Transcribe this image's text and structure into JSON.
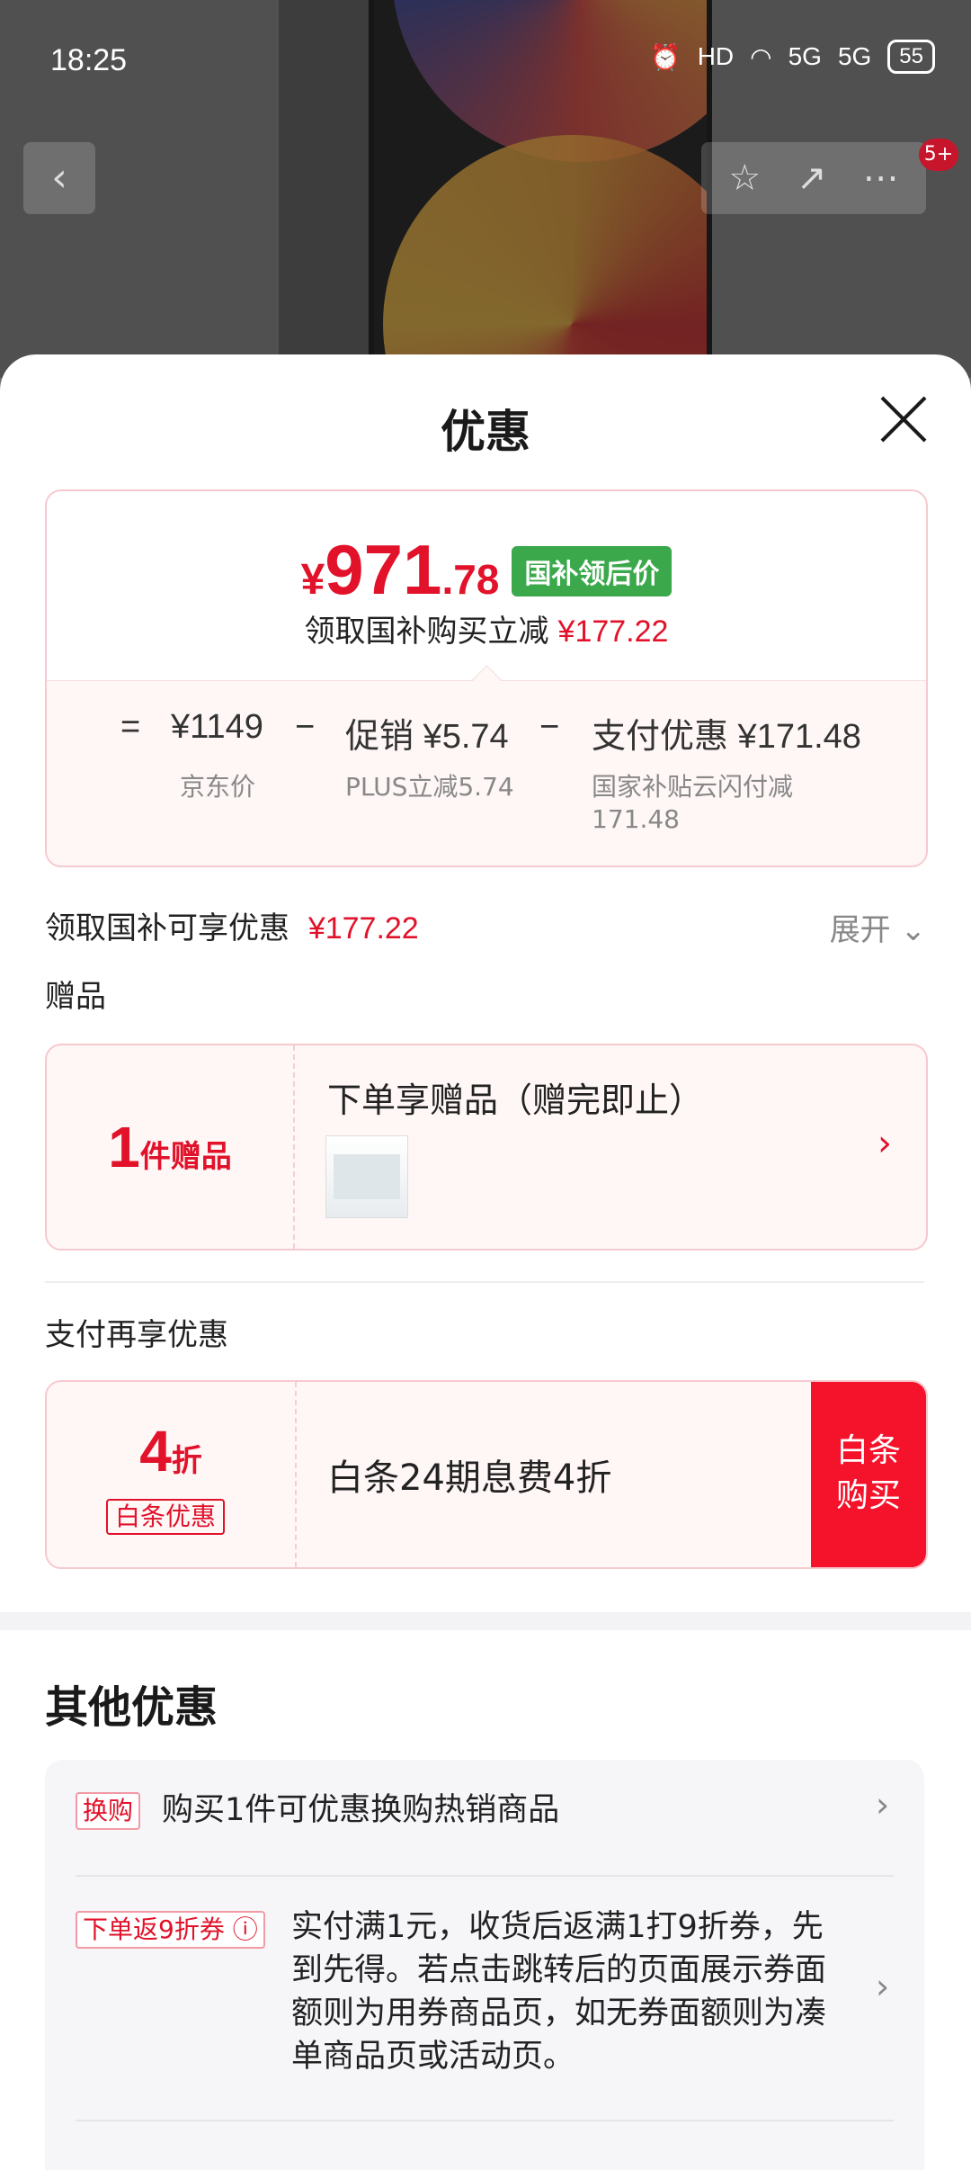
{
  "status_bar": {
    "time": "18:25",
    "battery": "55",
    "hd": "HD",
    "network1": "5G",
    "network2": "5G"
  },
  "background": {
    "cart_badge": "5+"
  },
  "sheet": {
    "title": "优惠"
  },
  "price_card": {
    "currency": "¥",
    "price_int": "971",
    "price_dec": ".78",
    "tag": "国补领后价",
    "subtitle": "领取国补购买立减",
    "subtitle_amount": "¥177.22",
    "eq": "=",
    "minus": "−",
    "items": [
      {
        "label": "¥1149",
        "sub": "京东价"
      },
      {
        "label": "促销 ¥5.74",
        "sub": "PLUS立减5.74"
      },
      {
        "label": "支付优惠 ¥171.48",
        "sub_line1": "国家补贴云闪付减",
        "sub_line2": "171.48"
      }
    ]
  },
  "subsidy_row": {
    "label": "领取国补可享优惠",
    "amount": "¥177.22",
    "expand": "展开"
  },
  "gift": {
    "section": "赠品",
    "count": "1",
    "count_suffix": "件赠品",
    "title": "下单享赠品（赠完即止）"
  },
  "payment": {
    "section": "支付再享优惠",
    "discount_num": "4",
    "discount_suffix": "折",
    "tag": "白条优惠",
    "text": "白条24期息费4折",
    "button_line1": "白条",
    "button_line2": "购买"
  },
  "other": {
    "title": "其他优惠",
    "items": [
      {
        "tag": "换购",
        "text": "购买1件可优惠换购热销商品"
      },
      {
        "tag": "下单返9折券 ⓘ",
        "text_lines": [
          "实付满1元，收货后返满1打9折券，先",
          "到先得。若点击跳转后的页面展示券面",
          "额则为用券商品页，如无券面额则为凑",
          "单商品页或活动页。"
        ]
      }
    ]
  },
  "colors": {
    "accent": "#e1122a",
    "green_tag": "#3aa84b",
    "button": "#f5122b"
  }
}
